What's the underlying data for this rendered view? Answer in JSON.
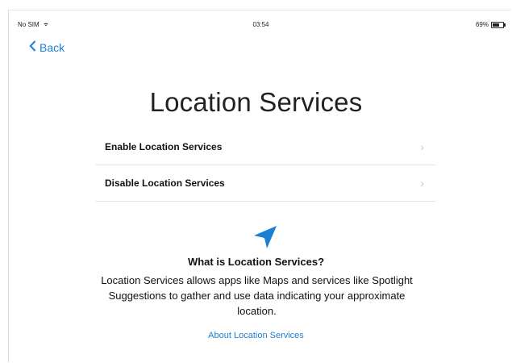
{
  "status_bar": {
    "carrier": "No SIM",
    "time": "03:54",
    "battery": "69%",
    "battery_level": 0.69
  },
  "nav": {
    "back_label": "Back"
  },
  "page": {
    "title": "Location Services"
  },
  "options": [
    {
      "label": "Enable Location Services"
    },
    {
      "label": "Disable Location Services"
    }
  ],
  "info": {
    "icon": "location-arrow-icon",
    "title": "What is Location Services?",
    "body": "Location Services allows apps like Maps and services like Spotlight Suggestions to gather and use data indicating your approximate location.",
    "link": "About Location Services"
  },
  "colors": {
    "accent": "#1a7fd4"
  }
}
